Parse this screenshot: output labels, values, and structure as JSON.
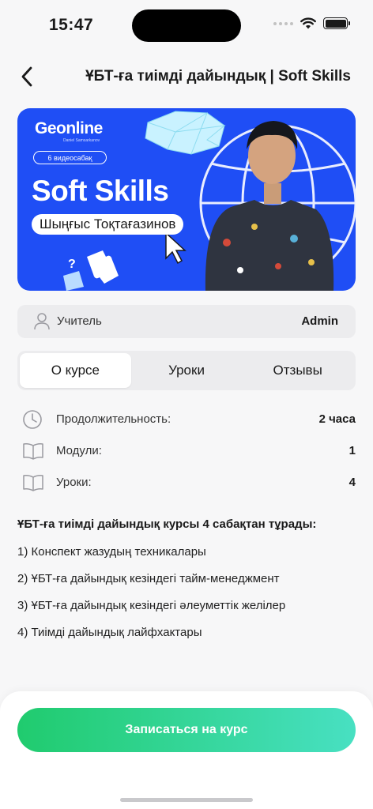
{
  "status_bar": {
    "time": "15:47"
  },
  "header": {
    "title": "ҰБТ-ға тиімді дайындық | Soft Skills",
    "back_icon": "chevron-left-icon"
  },
  "banner": {
    "logo": "Geonline",
    "logo_subtitle": "Daniel Samsarkanov",
    "pill": "6 видеосабақ",
    "heading": "Soft Skills",
    "author": "Шыңғыс Тоқтағазинов",
    "background_color": "#1f4ef5"
  },
  "teacher": {
    "label": "Учитель",
    "value": "Admin",
    "icon": "user-icon"
  },
  "tabs": [
    {
      "label": "О курсе",
      "active": true
    },
    {
      "label": "Уроки",
      "active": false
    },
    {
      "label": "Отзывы",
      "active": false
    }
  ],
  "info": [
    {
      "icon": "clock-icon",
      "label": "Продолжительность:",
      "value": "2 часа"
    },
    {
      "icon": "book-icon",
      "label": "Модули:",
      "value": "1"
    },
    {
      "icon": "book-icon",
      "label": "Уроки:",
      "value": "4"
    }
  ],
  "description": {
    "title": "ҰБТ-ға тиімді дайындық курсы 4 сабақтан тұрады:",
    "items": [
      "1)  Конспект жазудың техникалары",
      "2) ҰБТ-ға дайындық кезіндегі тайм-менеджмент",
      "3) ҰБТ-ға дайындық кезіндегі әлеуметтік желілер",
      "4) Тиімді дайындық лайфхактары"
    ]
  },
  "cta": {
    "label": "Записаться на курс",
    "gradient_start": "#20cb6e",
    "gradient_end": "#48e0c2"
  }
}
